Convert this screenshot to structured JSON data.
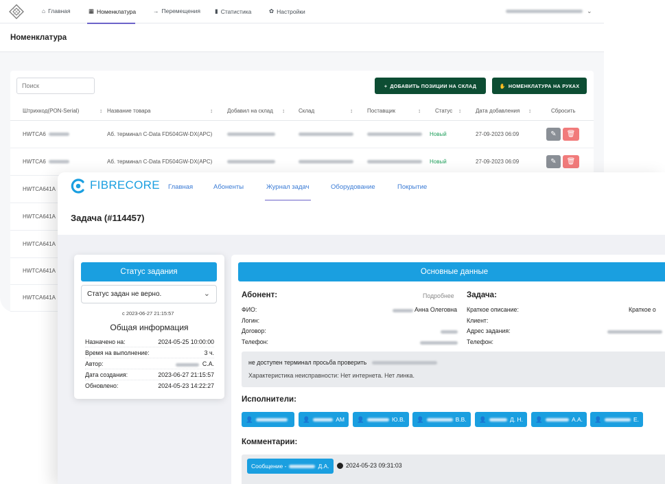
{
  "back": {
    "nav": [
      {
        "icon": "home-icon",
        "glyph": "⌂",
        "label": "Главная"
      },
      {
        "icon": "grid-icon",
        "glyph": "▦",
        "label": "Номенклатура"
      },
      {
        "icon": "arrow-right-icon",
        "glyph": "→",
        "label": "Перемещения"
      },
      {
        "icon": "bar-chart-icon",
        "glyph": "▮",
        "label": "Статистика"
      },
      {
        "icon": "gear-icon",
        "glyph": "✿",
        "label": "Настройки"
      }
    ],
    "page_title": "Номенклатура",
    "search_placeholder": "Поиск",
    "add_button": "ДОБАВИТЬ ПОЗИЦИИ НА СКЛАД",
    "hands_button": "НОМЕНКЛАТУРА НА РУКАХ",
    "columns": [
      "Штрихкод(PON-Serial)",
      "Название товара",
      "Добавил на склад",
      "Склад",
      "Поставщик",
      "Статус",
      "Дата добавления",
      "Сбросить"
    ],
    "rows": [
      {
        "serial": "HWTCA6",
        "name": "Аб. терминал C-Data FD504GW-DX(APC)",
        "status": "Новый",
        "date": "27-09-2023 06:09"
      },
      {
        "serial": "HWTCA6",
        "name": "Аб. терминал C-Data FD504GW-DX(APC)",
        "status": "Новый",
        "date": "27-09-2023 06:09"
      },
      {
        "serial": "HWTCA641A"
      },
      {
        "serial": "HWTCA641A"
      },
      {
        "serial": "HWTCA641A"
      },
      {
        "serial": "HWTCA641A"
      },
      {
        "serial": "HWTCA641A"
      }
    ],
    "status_color": "#1e9e5a",
    "accent": "#0d4d33"
  },
  "front": {
    "brand": "FIBRECORE",
    "nav": [
      "Главная",
      "Абоненты",
      "Журнал задач",
      "Оборудование",
      "Покрытие"
    ],
    "title": "Задача (#114457)",
    "status_card": {
      "header": "Статус задания",
      "select_value": "Статус задан не верно.",
      "since": "с 2023-06-27 21:15:57",
      "info_title": "Общая информация",
      "fields": [
        {
          "k": "Назначено на:",
          "v": "2024-05-25 10:00:00"
        },
        {
          "k": "Время на выполнение:",
          "v": "3 ч."
        },
        {
          "k": "Автор:",
          "v": "С.А."
        },
        {
          "k": "Дата создания:",
          "v": "2023-06-27 21:15:57"
        },
        {
          "k": "Обновлено:",
          "v": "2024-05-23 14:22:27"
        }
      ]
    },
    "main": {
      "header": "Основные данные",
      "abonent_title": "Абонент:",
      "more_link": "Подробнее",
      "abonent_fields": [
        {
          "k": "ФИО:",
          "v": "Анна Олеговна"
        },
        {
          "k": "Логин:",
          "v": ""
        },
        {
          "k": "Договор:",
          "v": ""
        },
        {
          "k": "Телефон:",
          "v": ""
        }
      ],
      "task_title": "Задача:",
      "task_fields": [
        {
          "k": "Краткое описание:",
          "v": "Краткое о"
        },
        {
          "k": "Клиент:",
          "v": ""
        },
        {
          "k": "Адрес задания:",
          "v": ""
        },
        {
          "k": "Телефон:",
          "v": ""
        }
      ],
      "note": "не доступен терминал просьба проверить",
      "fault": "Характеристика неисправности: Нет интернета. Нет линка.",
      "executors_title": "Исполнители:",
      "executors": [
        "",
        "АМ",
        "Ю.В.",
        "В.В.",
        "Д. Н.",
        "А.А.",
        "Е."
      ],
      "comments_title": "Комментарии:",
      "comment_author": "Д.А.",
      "comment_label": "Сообщение -",
      "comment_time": "2024-05-23 09:31:03"
    },
    "brand_color": "#1a9fe0"
  }
}
